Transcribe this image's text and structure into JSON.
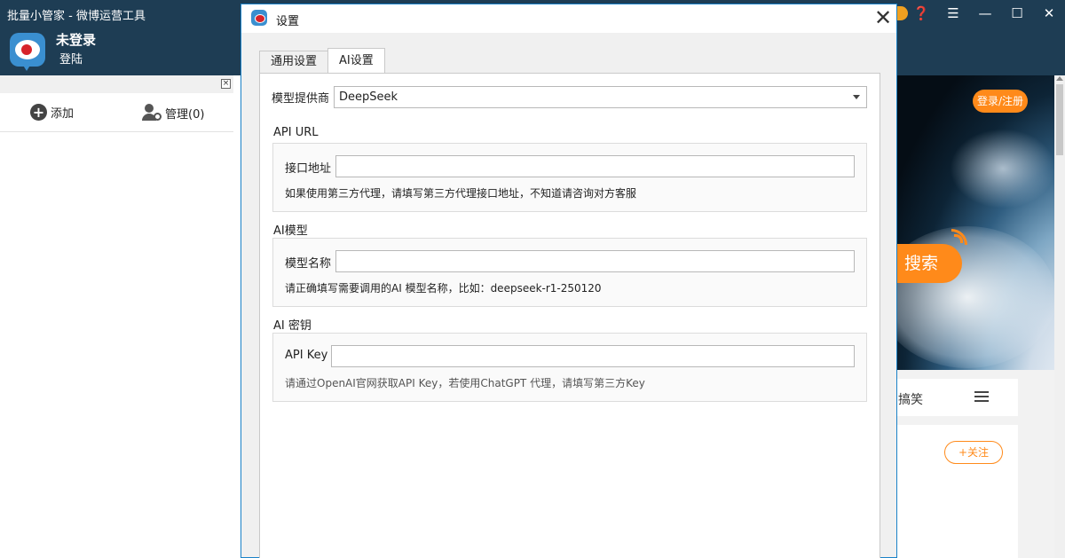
{
  "app": {
    "title": "批量小管家 - 微博运营工具",
    "user_name": "未登录",
    "login_link": "登陆"
  },
  "left_panel": {
    "close_glyph": "×",
    "add_label": "添加",
    "manage_label": "管理(0)"
  },
  "browser": {
    "login_register": "登录/注册",
    "search_label": "搜索",
    "category_funny": "搞笑",
    "follow_label": "+关注"
  },
  "dialog": {
    "title": "设置",
    "close_glyph": "✕",
    "tabs": [
      {
        "label": "通用设置",
        "active": false
      },
      {
        "label": "AI设置",
        "active": true
      }
    ],
    "provider": {
      "label": "模型提供商",
      "value": "DeepSeek"
    },
    "api_url": {
      "section": "API URL",
      "label": "接口地址",
      "value": "",
      "hint": "如果使用第三方代理，请填写第三方代理接口地址，不知道请咨询对方客服"
    },
    "ai_model": {
      "section": "AI模型",
      "label": "模型名称",
      "value": "",
      "hint": "请正确填写需要调用的AI 模型名称，比如：deepseek-r1-250120"
    },
    "api_key": {
      "section": "AI 密钥",
      "label": "API Key",
      "value": "",
      "hint": "请通过OpenAI官网获取API Key，若使用ChatGPT 代理，请填写第三方Key"
    }
  },
  "colors": {
    "header_bg": "#1e3d54",
    "accent_orange": "#ff8a1a",
    "dialog_border": "#1a82c8"
  }
}
